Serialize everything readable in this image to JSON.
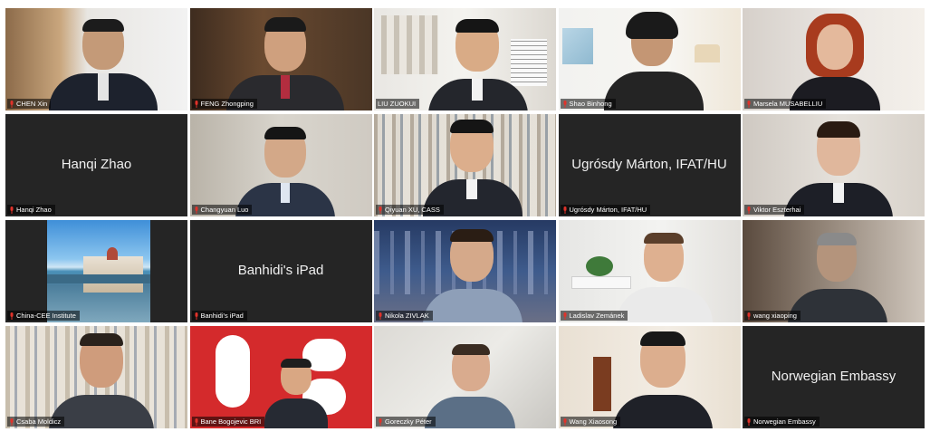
{
  "colors": {
    "active_speaker_border": "#33c23a",
    "muted_mic": "#e0322a",
    "tile_background": "#252525"
  },
  "participants": [
    {
      "name": "CHEN Xin",
      "video": true,
      "muted": true
    },
    {
      "name": "FENG Zhongping",
      "video": true,
      "muted": true
    },
    {
      "name": "LIU ZUOKUI",
      "video": true,
      "muted": false,
      "active_speaker": true
    },
    {
      "name": "Shao Binhong",
      "video": true,
      "muted": true
    },
    {
      "name": "Marsela MUSABELLIU",
      "video": true,
      "muted": true
    },
    {
      "name": "Hanqi Zhao",
      "video": false,
      "display_name": "Hanqi Zhao",
      "muted": true
    },
    {
      "name": "Changyuan Luo",
      "video": true,
      "muted": true
    },
    {
      "name": "Qiyuan XU, CASS",
      "video": true,
      "muted": true
    },
    {
      "name": "Ugrósdy Márton, IFAT/HU",
      "video": false,
      "display_name": "Ugrósdy Márton, IFAT/HU",
      "muted": true
    },
    {
      "name": "Viktor Eszterhai",
      "video": true,
      "muted": true
    },
    {
      "name": "China-CEE Institute",
      "video": true,
      "muted": true
    },
    {
      "name": "Banhidi's iPad",
      "video": false,
      "display_name": "Banhidi's iPad",
      "muted": true
    },
    {
      "name": "Nikola ZIVLAK",
      "video": true,
      "muted": true
    },
    {
      "name": "Ladislav Zemánek",
      "video": true,
      "muted": true
    },
    {
      "name": "wang xiaoping",
      "video": true,
      "muted": true
    },
    {
      "name": "Csaba Moldicz",
      "video": true,
      "muted": true
    },
    {
      "name": "Bane Bogojevic BRI",
      "video": true,
      "muted": true
    },
    {
      "name": "Goreczky Péter",
      "video": true,
      "muted": true
    },
    {
      "name": "Wang Xiaosong",
      "video": true,
      "muted": true
    },
    {
      "name": "Norwegian Embassy",
      "video": false,
      "display_name": "Norwegian Embassy",
      "muted": true
    }
  ]
}
